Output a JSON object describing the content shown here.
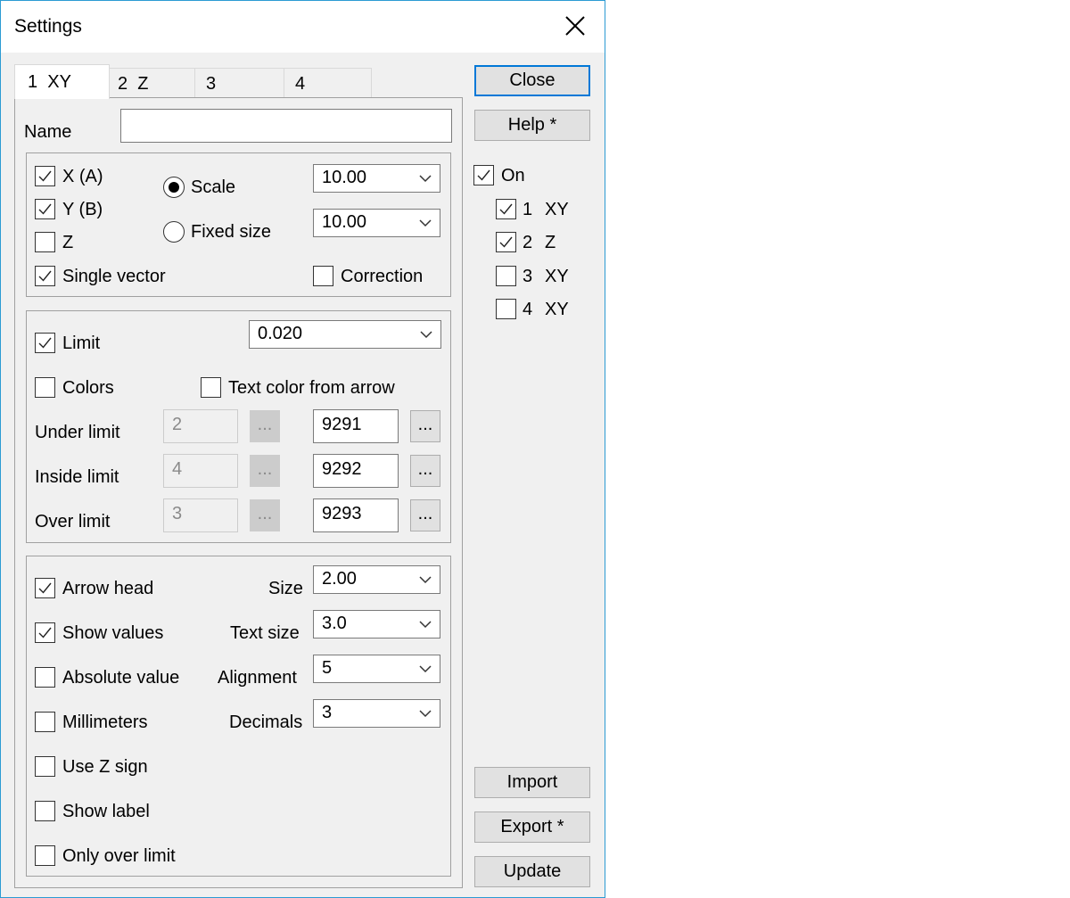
{
  "window": {
    "title": "Settings"
  },
  "tabs": [
    {
      "label": "1  XY",
      "active": true
    },
    {
      "label": "2  Z",
      "active": false
    },
    {
      "label": "3",
      "active": false
    },
    {
      "label": "4",
      "active": false
    }
  ],
  "name_field": {
    "label": "Name",
    "value": ""
  },
  "vector_group": {
    "x_a": {
      "label": "X (A)",
      "checked": true
    },
    "y_b": {
      "label": "Y (B)",
      "checked": true
    },
    "z": {
      "label": "Z",
      "checked": false
    },
    "single_vector": {
      "label": "Single vector",
      "checked": true
    },
    "scale": {
      "label": "Scale",
      "selected": true,
      "value": "10.00"
    },
    "fixed_size": {
      "label": "Fixed size",
      "selected": false,
      "value": "10.00"
    },
    "correction": {
      "label": "Correction",
      "checked": false
    }
  },
  "limit_group": {
    "limit": {
      "label": "Limit",
      "checked": true,
      "value": "0.020"
    },
    "colors": {
      "label": "Colors",
      "checked": false
    },
    "text_color_from_arrow": {
      "label": "Text color from arrow",
      "checked": false
    },
    "ellipsis": "...",
    "rows": [
      {
        "label": "Under limit",
        "color_index": "2",
        "code": "9291"
      },
      {
        "label": "Inside limit",
        "color_index": "4",
        "code": "9292"
      },
      {
        "label": "Over limit",
        "color_index": "3",
        "code": "9293"
      }
    ]
  },
  "options_group": {
    "arrow_head": {
      "label": "Arrow head",
      "checked": true
    },
    "show_values": {
      "label": "Show values",
      "checked": true
    },
    "absolute_value": {
      "label": "Absolute value",
      "checked": false
    },
    "millimeters": {
      "label": "Millimeters",
      "checked": false
    },
    "use_z_sign": {
      "label": "Use Z sign",
      "checked": false
    },
    "show_label": {
      "label": "Show label",
      "checked": false
    },
    "only_over_limit": {
      "label": "Only over limit",
      "checked": false
    },
    "size": {
      "label": "Size",
      "value": "2.00"
    },
    "text_size": {
      "label": "Text size",
      "value": "3.0"
    },
    "alignment": {
      "label": "Alignment",
      "value": "5"
    },
    "decimals": {
      "label": "Decimals",
      "value": "3"
    }
  },
  "side_panel": {
    "close_label": "Close",
    "help_label": "Help *",
    "on": {
      "label": "On",
      "checked": true
    },
    "layers": [
      {
        "num": "1",
        "name": "XY",
        "checked": true
      },
      {
        "num": "2",
        "name": "Z",
        "checked": true
      },
      {
        "num": "3",
        "name": "XY",
        "checked": false
      },
      {
        "num": "4",
        "name": "XY",
        "checked": false
      }
    ],
    "import_label": "Import",
    "export_label": "Export *",
    "update_label": "Update"
  },
  "icons": {
    "close": "close-icon",
    "check": "checkmark-icon",
    "dropdown": "chevron-down-icon"
  }
}
